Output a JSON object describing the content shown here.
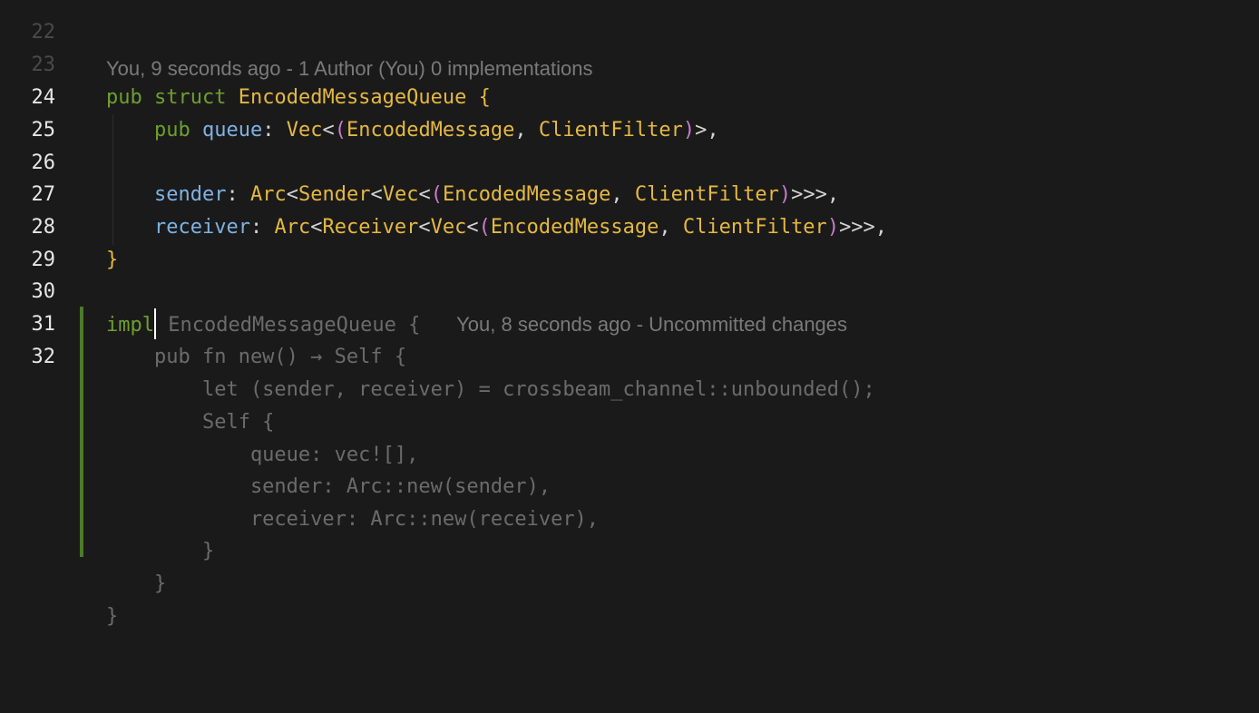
{
  "colors": {
    "background": "#1a1a1a",
    "keyword": "#6e9f2f",
    "type": "#e5b842",
    "field": "#7fb2e5",
    "paren": "#c77dcc",
    "ghost_text": "#6b6b6b",
    "diff_added": "#4c7a2a"
  },
  "gutter": {
    "line_numbers": [
      "22",
      "23",
      "24",
      "25",
      "26",
      "27",
      "28",
      "29",
      "30",
      "31",
      "32"
    ]
  },
  "blame": {
    "line23": "You, 9 seconds ago - 1 Author (You) 0 implementations",
    "line31": "You, 8 seconds ago - Uncommitted changes"
  },
  "code": {
    "l24": {
      "pub": "pub",
      "struct": "struct",
      "name": "EncodedMessageQueue",
      "brace": "{"
    },
    "l25": {
      "pub": "pub",
      "field": "queue",
      "colon": ":",
      "vec": "Vec",
      "lt": "<",
      "lparen": "(",
      "t1": "EncodedMessage",
      "comma": ",",
      "t2": "ClientFilter",
      "rparen": ")",
      "gt": ">,"
    },
    "l27": {
      "field": "sender",
      "colon": ":",
      "arc": "Arc",
      "lt1": "<",
      "inner": "Sender",
      "lt2": "<",
      "vec": "Vec",
      "lt3": "<",
      "lparen": "(",
      "t1": "EncodedMessage",
      "comma": ",",
      "t2": "ClientFilter",
      "rparen": ")",
      "gt": ">>>,"
    },
    "l28": {
      "field": "receiver",
      "colon": ":",
      "arc": "Arc",
      "lt1": "<",
      "inner": "Receiver",
      "lt2": "<",
      "vec": "Vec",
      "lt3": "<",
      "lparen": "(",
      "t1": "EncodedMessage",
      "comma": ",",
      "t2": "ClientFilter",
      "rparen": ")",
      "gt": ">>>,"
    },
    "l29": {
      "brace": "}"
    },
    "l31": {
      "keyword": "impl",
      "rest": " EncodedMessageQueue {"
    },
    "suggestion": [
      "    pub fn new() → Self {",
      "        let (sender, receiver) = crossbeam_channel::unbounded();",
      "        Self {",
      "            queue: vec![],",
      "            sender: Arc::new(sender),",
      "            receiver: Arc::new(receiver),",
      "        }",
      "    }",
      "}"
    ]
  }
}
